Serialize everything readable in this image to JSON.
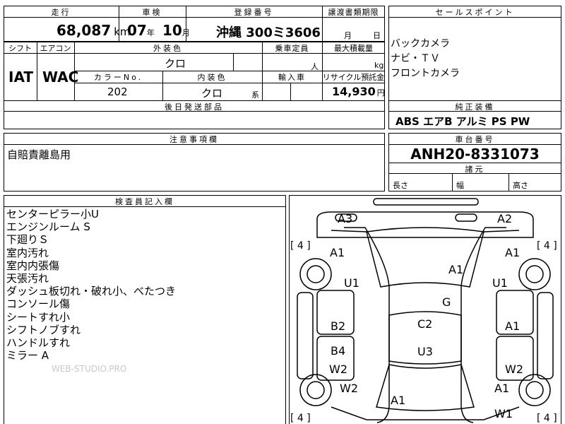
{
  "summary": {
    "mileage_header": "走行",
    "mileage_value": "68,087",
    "mileage_unit": "km",
    "inspection_header": "車検",
    "inspection_year": "07",
    "inspection_year_unit": "年",
    "inspection_month": "10",
    "inspection_month_unit": "月",
    "registration_header": "登録番号",
    "registration_value": "沖縄 300ミ3606",
    "transfer_header": "譲渡書類期限",
    "transfer_month_unit": "月",
    "transfer_day_unit": "日"
  },
  "specs": {
    "shift_header": "シフト",
    "shift_value": "IAT",
    "aircon_header": "エアコン",
    "aircon_value": "WAC",
    "exterior_header": "外装色",
    "exterior_value": "クロ",
    "capacity_header": "乗車定員",
    "capacity_unit": "人",
    "load_header": "最大積載量",
    "load_unit": "kg",
    "color_no_header": "カラーNo.",
    "color_no_value": "202",
    "interior_header": "内装色",
    "interior_value": "クロ",
    "interior_suffix": "系",
    "import_header": "輸入車",
    "recycle_header": "リサイクル預託金",
    "recycle_value": "14,930",
    "recycle_unit": "円",
    "parts_header": "後日発送部品"
  },
  "sales_points": {
    "header": "セールスポイント",
    "items": [
      "バックカメラ",
      "ナビ・ＴＶ",
      "フロントカメラ"
    ]
  },
  "equipment": {
    "header": "純正装備",
    "value": "ABS エアB アルミ PS PW"
  },
  "notes": {
    "header": "注意事項欄",
    "text": "自賠責離島用"
  },
  "chassis": {
    "header": "車台番号",
    "value": "ANH20-8331073",
    "dims_header": "諸元",
    "length_label": "長さ",
    "width_label": "幅",
    "height_label": "高さ"
  },
  "inspector": {
    "header": "検査員記入欄",
    "lines": [
      "センターピラー小U",
      "エンジンルーム S",
      "下廻りＳ",
      "室内汚れ",
      "室内内張傷",
      "天張汚れ",
      "ダッシュ板切れ・破れ小、べたつき",
      "コンソール傷",
      "シートすれ小",
      "シフトノブすれ",
      "ハンドルすれ",
      "ミラー A"
    ],
    "watermark": "WEB-STUDIO.PRO"
  },
  "diagram": {
    "tire_labels": [
      "[ 4 ]",
      "[ 4 ]",
      "[ 4 ]",
      "[ 4 ]"
    ],
    "marks": [
      "A3",
      "A2",
      "A1",
      "A1",
      "A1",
      "U1",
      "U1",
      "G",
      "B2",
      "C2",
      "A1",
      "B4",
      "U3",
      "W2",
      "W2",
      "W2",
      "A1",
      "A1",
      "W1"
    ]
  }
}
